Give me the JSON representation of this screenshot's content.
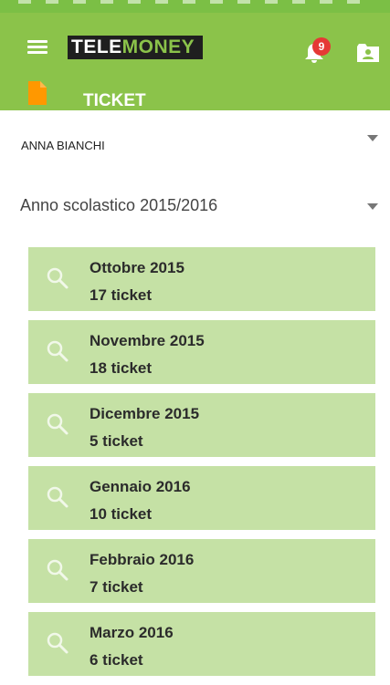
{
  "header": {
    "brand_part1": "TELE",
    "brand_part2": "MONEY",
    "notification_count": "9",
    "page_title": "TICKET",
    "colors": {
      "primary": "#8bc34a",
      "card": "#c5e1a5",
      "badge": "#e53935",
      "page_icon": "#ff9800"
    },
    "icons": [
      "menu-icon",
      "bell-icon",
      "contact-card-icon",
      "document-icon"
    ]
  },
  "student_select": {
    "selected": "ANNA BIANCHI"
  },
  "year_select": {
    "selected": "Anno scolastico 2015/2016"
  },
  "months": [
    {
      "name": "Ottobre 2015",
      "tickets": "17 ticket"
    },
    {
      "name": "Novembre 2015",
      "tickets": "18 ticket"
    },
    {
      "name": "Dicembre 2015",
      "tickets": "5 ticket"
    },
    {
      "name": "Gennaio 2016",
      "tickets": "10 ticket"
    },
    {
      "name": "Febbraio 2016",
      "tickets": "7 ticket"
    },
    {
      "name": "Marzo 2016",
      "tickets": "6 ticket"
    }
  ]
}
